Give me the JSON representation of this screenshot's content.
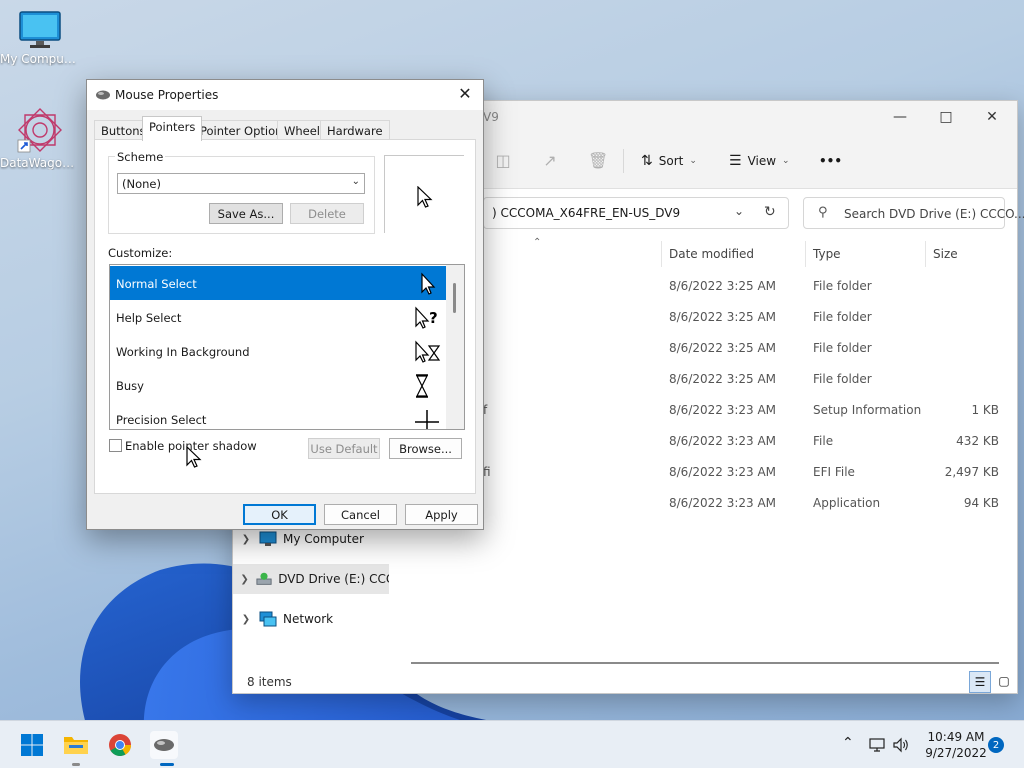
{
  "desktop": {
    "icons": [
      {
        "label": "My Computer"
      },
      {
        "label": "DataWagon..."
      }
    ]
  },
  "explorer": {
    "title_fragment": "V9",
    "toolbar": {
      "sort_label": "Sort",
      "view_label": "View",
      "more_label": "•••"
    },
    "address": "CCCOMA_X64FRE_EN-US_DV9",
    "address_prefix": ")",
    "search_placeholder": "Search DVD Drive (E:) CCCO...",
    "columns": {
      "date": "Date modified",
      "type": "Type",
      "size": "Size"
    },
    "rows": [
      {
        "name": "",
        "date": "8/6/2022 3:25 AM",
        "type": "File folder",
        "size": ""
      },
      {
        "name": "",
        "date": "8/6/2022 3:25 AM",
        "type": "File folder",
        "size": ""
      },
      {
        "name": "",
        "date": "8/6/2022 3:25 AM",
        "type": "File folder",
        "size": ""
      },
      {
        "name": "",
        "date": "8/6/2022 3:25 AM",
        "type": "File folder",
        "size": ""
      },
      {
        "name": "f",
        "date": "8/6/2022 3:23 AM",
        "type": "Setup Information",
        "size": "1 KB"
      },
      {
        "name": "",
        "date": "8/6/2022 3:23 AM",
        "type": "File",
        "size": "432 KB"
      },
      {
        "name": "fi",
        "date": "8/6/2022 3:23 AM",
        "type": "EFI File",
        "size": "2,497 KB"
      },
      {
        "name": "",
        "date": "8/6/2022 3:23 AM",
        "type": "Application",
        "size": "94 KB"
      }
    ],
    "nav": [
      {
        "label": "My Computer"
      },
      {
        "label": "DVD Drive (E:) CCCC"
      },
      {
        "label": "Network"
      }
    ],
    "status": "8 items"
  },
  "dialog": {
    "title": "Mouse Properties",
    "tabs": [
      "Buttons",
      "Pointers",
      "Pointer Options",
      "Wheel",
      "Hardware"
    ],
    "scheme_label": "Scheme",
    "scheme_value": "(None)",
    "save_as_label": "Save As...",
    "delete_label": "Delete",
    "customize_label": "Customize:",
    "pointers": [
      {
        "label": "Normal Select"
      },
      {
        "label": "Help Select"
      },
      {
        "label": "Working In Background"
      },
      {
        "label": "Busy"
      },
      {
        "label": "Precision Select"
      }
    ],
    "shadow_label": "Enable pointer shadow",
    "use_default_label": "Use Default",
    "browse_label": "Browse...",
    "ok_label": "OK",
    "cancel_label": "Cancel",
    "apply_label": "Apply"
  },
  "taskbar": {
    "time": "10:49 AM",
    "date": "9/27/2022",
    "notifications": "2"
  },
  "colors": {
    "accent": "#0078d4",
    "selection": "#0078d4"
  }
}
